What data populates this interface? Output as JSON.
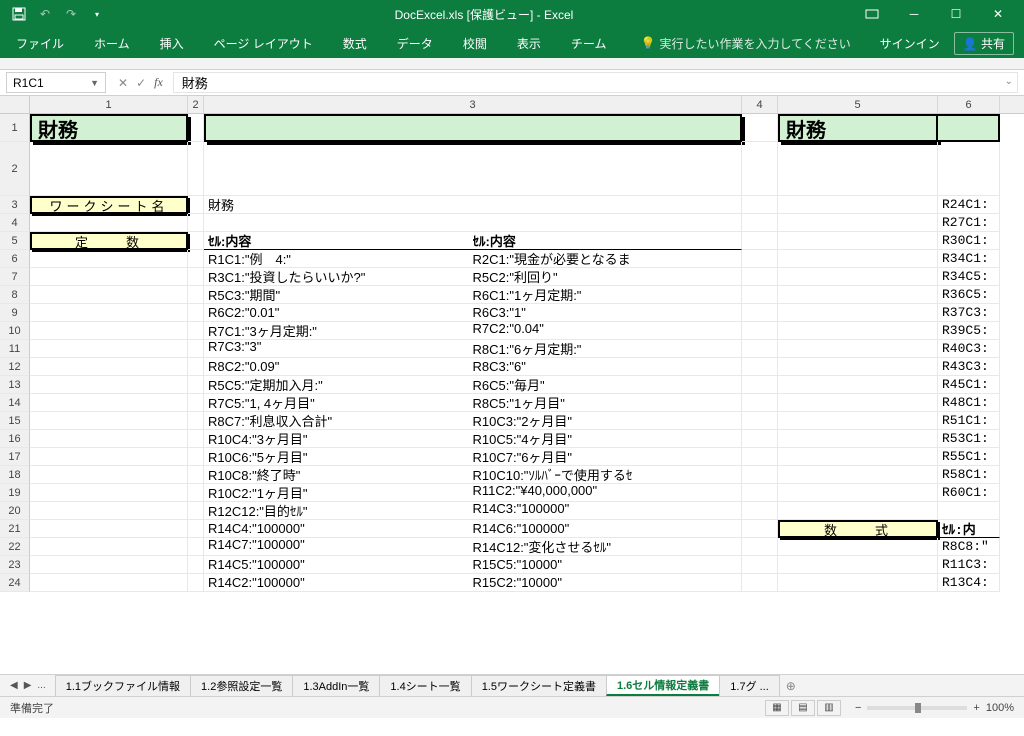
{
  "window": {
    "title": "DocExcel.xls  [保護ビュー] - Excel",
    "signin": "サインイン",
    "share": "共有"
  },
  "ribbon_tabs": [
    "ファイル",
    "ホーム",
    "挿入",
    "ページ レイアウト",
    "数式",
    "データ",
    "校閲",
    "表示",
    "チーム"
  ],
  "tellme": "実行したい作業を入力してください",
  "namebox": "R1C1",
  "formula": "財務",
  "col_headers": [
    "1",
    "2",
    "3",
    "4",
    "5",
    "6"
  ],
  "row_numbers": [
    "1",
    "2",
    "3",
    "4",
    "5",
    "6",
    "7",
    "8",
    "9",
    "10",
    "11",
    "12",
    "13",
    "14",
    "15",
    "16",
    "17",
    "18",
    "19",
    "20",
    "21",
    "22",
    "23",
    "24"
  ],
  "sheet": {
    "title_left": "財務",
    "title_right": "財務",
    "wslabel": "ワークシート名",
    "wsname": "財務",
    "const_label": "定　　数",
    "hdr_left": "ｾﾙ:内容",
    "hdr_right": "ｾﾙ:内容",
    "formula_label": "数　　式",
    "hdr_r6": "ｾﾙ:内"
  },
  "cells": {
    "r6": {
      "l": "R1C1:\"例　4:\"",
      "r": "R2C1:\"現金が必要となるま"
    },
    "r7": {
      "l": "R3C1:\"投資したらいいか?\"",
      "r": "R5C2:\"利回り\""
    },
    "r8": {
      "l": "R5C3:\"期間\"",
      "r": "R6C1:\"1ヶ月定期:\""
    },
    "r9": {
      "l": "R6C2:\"0.01\"",
      "r": "R6C3:\"1\""
    },
    "r10": {
      "l": "R7C1:\"3ヶ月定期:\"",
      "r": "R7C2:\"0.04\""
    },
    "r11": {
      "l": "R7C3:\"3\"",
      "r": "R8C1:\"6ヶ月定期:\""
    },
    "r12": {
      "l": "R8C2:\"0.09\"",
      "r": "R8C3:\"6\""
    },
    "r13": {
      "l": "R5C5:\"定期加入月:\"",
      "r": "R6C5:\"毎月\""
    },
    "r14": {
      "l": "R7C5:\"1, 4ヶ月目\"",
      "r": "R8C5:\"1ヶ月目\""
    },
    "r15": {
      "l": "R8C7:\"利息収入合計\"",
      "r": "R10C3:\"2ヶ月目\""
    },
    "r16": {
      "l": "R10C4:\"3ヶ月目\"",
      "r": "R10C5:\"4ヶ月目\""
    },
    "r17": {
      "l": "R10C6:\"5ヶ月目\"",
      "r": "R10C7:\"6ヶ月目\""
    },
    "r18": {
      "l": "R10C8:\"終了時\"",
      "r": "R10C10:\"ｿﾙﾊﾞｰで使用するｾ"
    },
    "r19": {
      "l": "R10C2:\"1ヶ月目\"",
      "r": "R11C2:\"¥40,000,000\""
    },
    "r20": {
      "l": "R12C12:\"目的ｾﾙ\"",
      "r": "R14C3:\"100000\""
    },
    "r21": {
      "l": "R14C4:\"100000\"",
      "r": "R14C6:\"100000\""
    },
    "r22": {
      "l": "R14C7:\"100000\"",
      "r": "R14C12:\"変化させるｾﾙ\""
    },
    "r23": {
      "l": "R14C5:\"100000\"",
      "r": "R15C5:\"10000\""
    },
    "r24": {
      "l": "R14C2:\"100000\"",
      "r": "R15C2:\"10000\""
    }
  },
  "col6": {
    "r3": "R24C1:",
    "r4": "R27C1:",
    "r5": "R30C1:",
    "r6": "R34C1:",
    "r7": "R34C5:",
    "r8": "R36C5:",
    "r9": "R37C3:",
    "r10": "R39C5:",
    "r11": "R40C3:",
    "r12": "R43C3:",
    "r13": "R45C1:",
    "r14": "R48C1:",
    "r15": "R51C1:",
    "r16": "R53C1:",
    "r17": "R55C1:",
    "r18": "R58C1:",
    "r19": "R60C1:",
    "r22": "R8C8:\"",
    "r23": "R11C3:",
    "r24": "R13C4:"
  },
  "tabs": [
    "1.1ブックファイル情報",
    "1.2参照設定一覧",
    "1.3AddIn一覧",
    "1.4シート一覧",
    "1.5ワークシート定義書",
    "1.6セル情報定義書",
    "1.7グ ..."
  ],
  "active_tab": 5,
  "status": "準備完了",
  "zoom": "100%",
  "chart_data": null
}
